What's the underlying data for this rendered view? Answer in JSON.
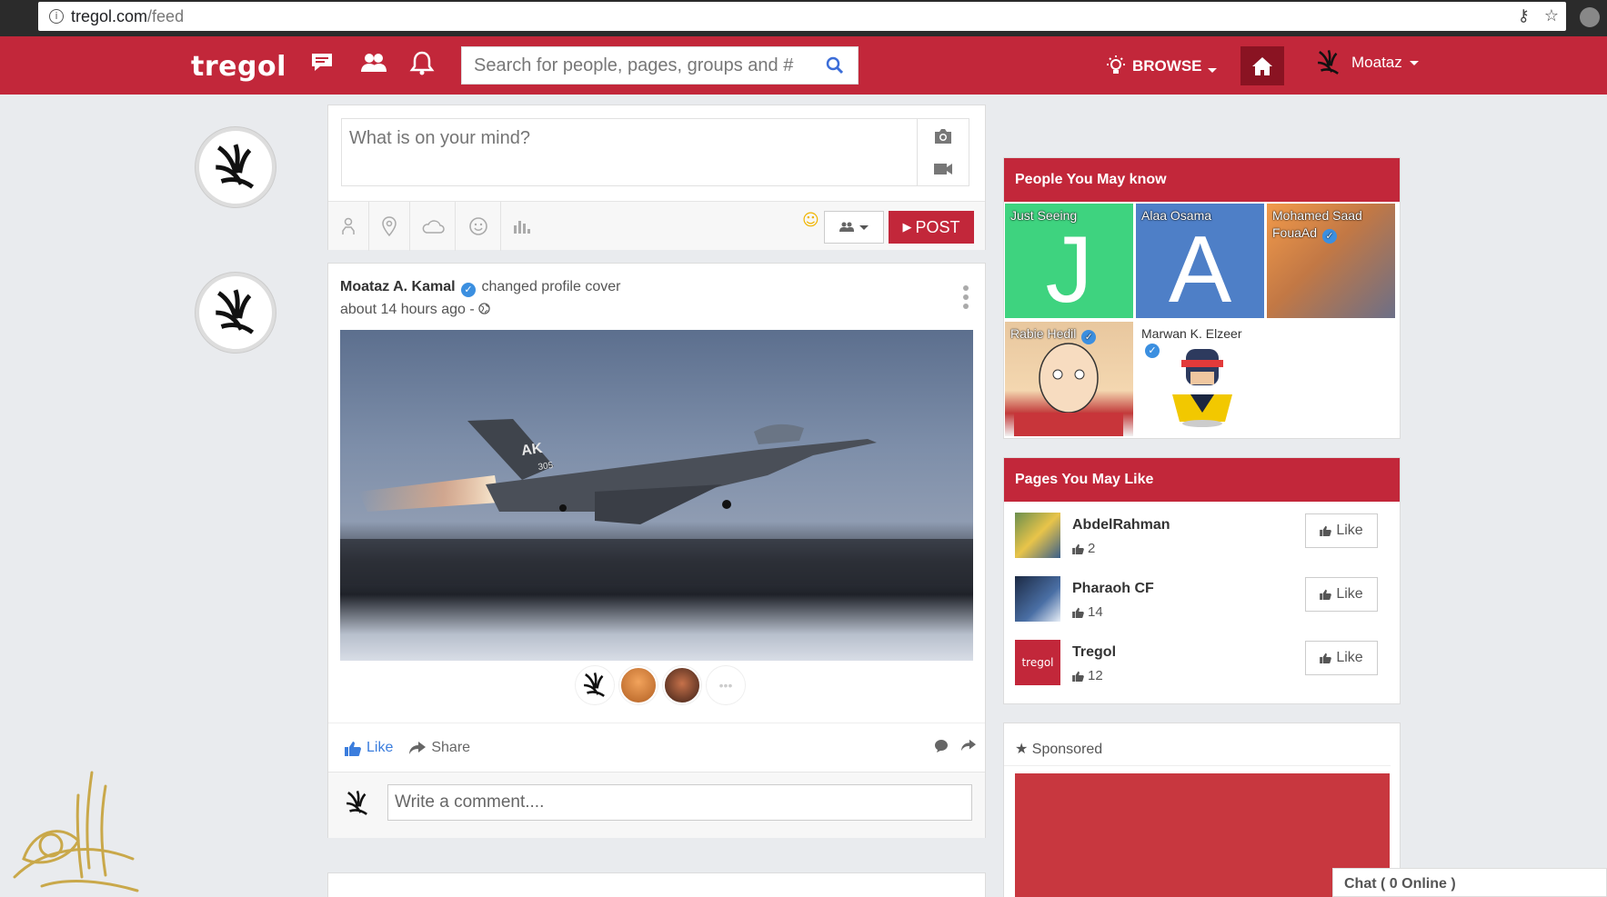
{
  "browser": {
    "url_host": "tregol.com",
    "url_path": "/feed",
    "info_icon": "info-icon",
    "key_icon": "key-icon",
    "star_icon": "star-icon"
  },
  "nav": {
    "logo": "tregol",
    "search_placeholder": "Search for people, pages, groups and #",
    "browse_label": "BROWSE",
    "user_name": "Moataz",
    "accent_color": "#c2273a"
  },
  "composer": {
    "placeholder": "What is on your mind?",
    "post_label": "POST",
    "post_icon": "▶"
  },
  "post": {
    "author": "Moataz A. Kamal",
    "action": "changed profile cover",
    "time": "about 14 hours ago -",
    "like_label": "Like",
    "share_label": "Share",
    "comment_placeholder": "Write a comment....",
    "jet_tail": "AK",
    "jet_serial": "305"
  },
  "people": {
    "title": "People You May know",
    "items": [
      {
        "name": "Just Seeing",
        "letter": "J",
        "color": "#3ed37f"
      },
      {
        "name": "Alaa Osama",
        "letter": "A",
        "color": "#4e7fc7"
      },
      {
        "name": "Mohamed Saad FouaAd",
        "letter": "",
        "color": "#c58a57",
        "verified": true
      },
      {
        "name": "Rabie Hedil",
        "letter": "",
        "color": "#e8c79e",
        "verified": true
      },
      {
        "name": "Marwan K. Elzeer",
        "letter": "",
        "color": "#ffffff",
        "verified": true
      }
    ]
  },
  "pages": {
    "title": "Pages You May Like",
    "like_label": "Like",
    "items": [
      {
        "name": "AbdelRahman",
        "count": "2"
      },
      {
        "name": "Pharaoh CF",
        "count": "14"
      },
      {
        "name": "Tregol",
        "count": "12",
        "thumb_text": "tregol"
      }
    ]
  },
  "sponsored": {
    "label": "Sponsored"
  },
  "chat": {
    "label": "Chat ( 0 Online )"
  }
}
